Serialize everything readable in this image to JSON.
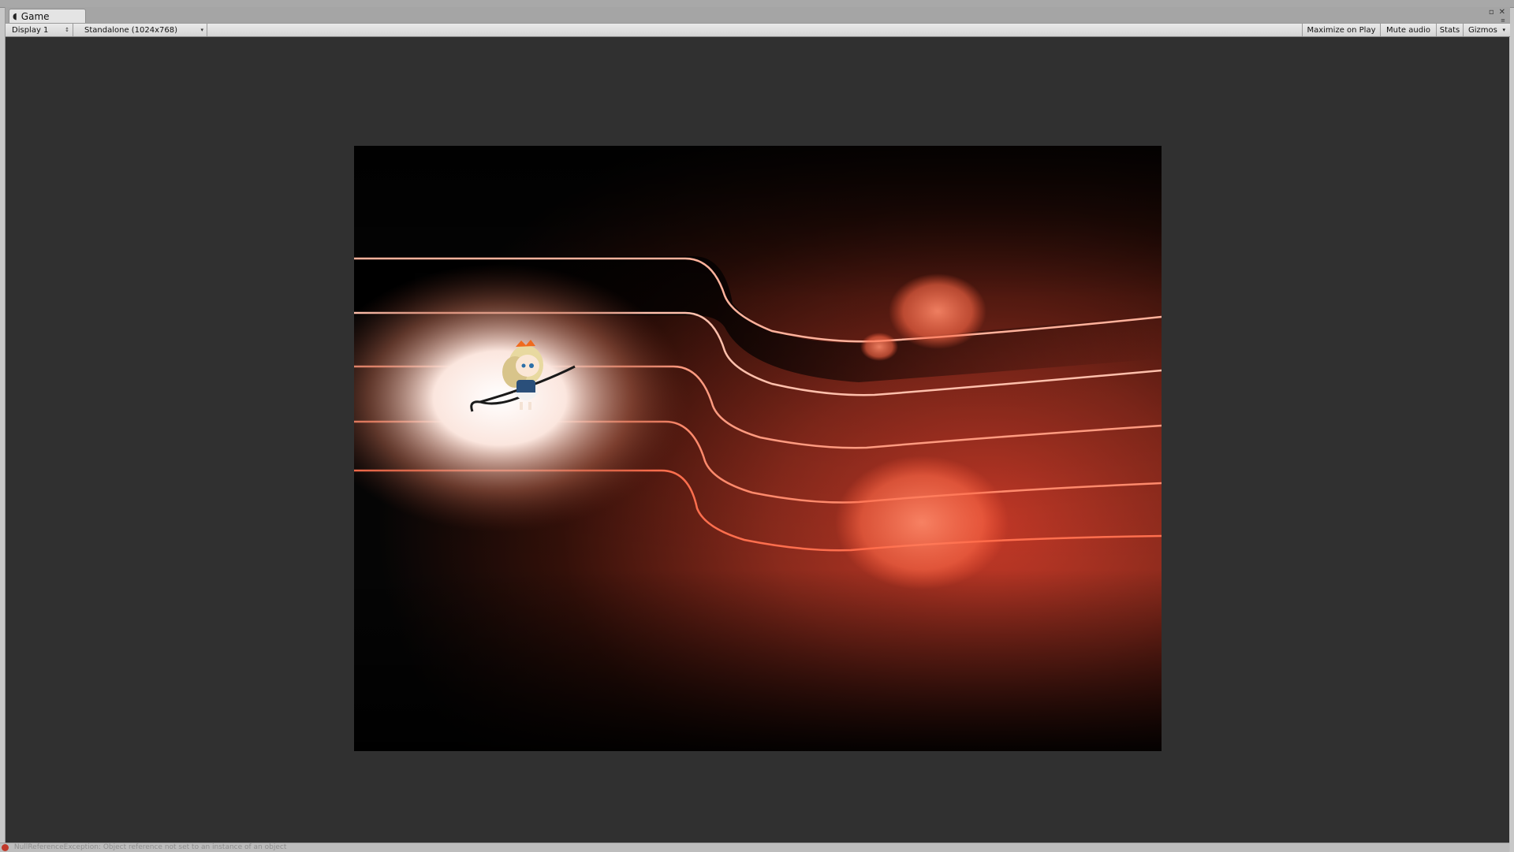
{
  "window": {
    "tab_label": "Game",
    "tab_icon": "pacman-game-icon"
  },
  "toolbar": {
    "display": "Display 1",
    "resolution": "Standalone (1024x768)",
    "maximize_on_play": "Maximize on Play",
    "mute_audio": "Mute audio",
    "stats": "Stats",
    "gizmos": "Gizmos"
  },
  "console": {
    "message": "NullReferenceException: Object reference not set to an instance of an object"
  },
  "colors": {
    "viewport_bg": "#303030",
    "accent_red": "#e0452f",
    "line_color": "#ff8f72"
  }
}
